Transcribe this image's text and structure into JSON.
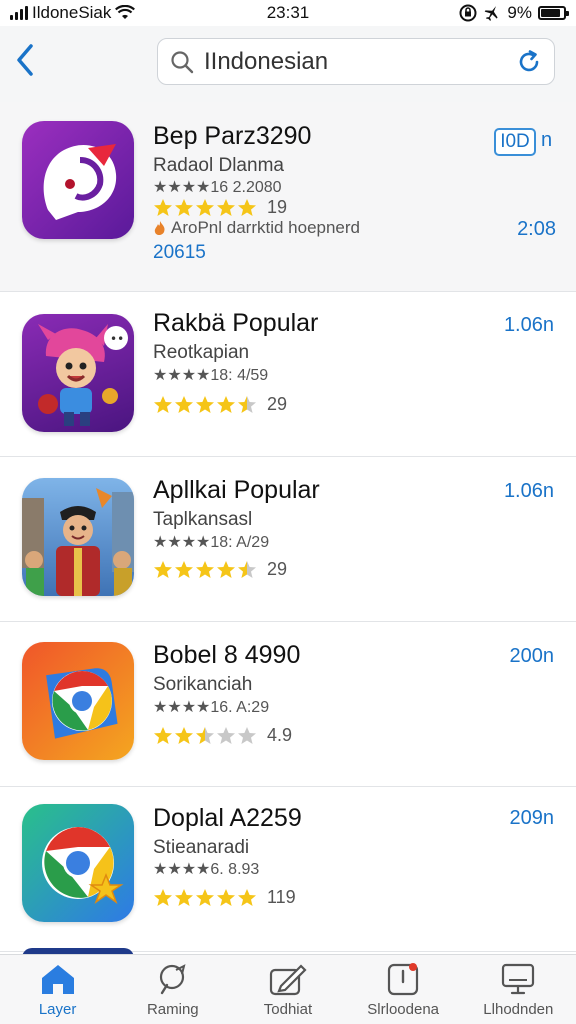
{
  "status_bar": {
    "carrier": "IldoneSiak",
    "time": "23:31",
    "battery": "9%"
  },
  "search": {
    "query": "IIndonesian"
  },
  "apps": [
    {
      "name": "Bep Parz3290",
      "developer": "Radaol Dlanma",
      "meta": "★★★★16  2.2080",
      "stars": 5,
      "rating_count": "19",
      "open_label": "I0D",
      "open_suffix": "n",
      "note": "AroPnl darrktid hoepnerd",
      "code": "20615",
      "size": "2:08"
    },
    {
      "name": "Rakbä Popular",
      "developer": "Reotkapian",
      "meta": "★★★★18:  4/59",
      "stars": 4.5,
      "rating_count": "29",
      "size": "1.06n"
    },
    {
      "name": "Apllkai Popular",
      "developer": "Taplkansasl",
      "meta": "★★★★18:  A/29",
      "stars": 4.5,
      "rating_count": "29",
      "size": "1.06n"
    },
    {
      "name": "Bobel 8 4990",
      "developer": "Sorikanciah",
      "meta": "★★★★16.  A:29",
      "stars": 2.5,
      "rating_count": "4.9",
      "size": "200n"
    },
    {
      "name": "Doplal A2259",
      "developer": "Stieanaradi",
      "meta": "★★★★6.  8.93",
      "stars": 5,
      "rating_count": "119",
      "size": "209n"
    }
  ],
  "tabs": [
    {
      "label": "Layer",
      "icon": "home-icon",
      "active": true
    },
    {
      "label": "Raming",
      "icon": "search-icon",
      "active": false
    },
    {
      "label": "Todhiat",
      "icon": "edit-icon",
      "active": false
    },
    {
      "label": "Slrloodena",
      "icon": "notification-icon",
      "active": false
    },
    {
      "label": "Llhodnden",
      "icon": "monitor-icon",
      "active": false
    }
  ],
  "colors": {
    "accent": "#1a73c8",
    "star": "#f5c518",
    "star_empty": "#c8c8c8"
  }
}
